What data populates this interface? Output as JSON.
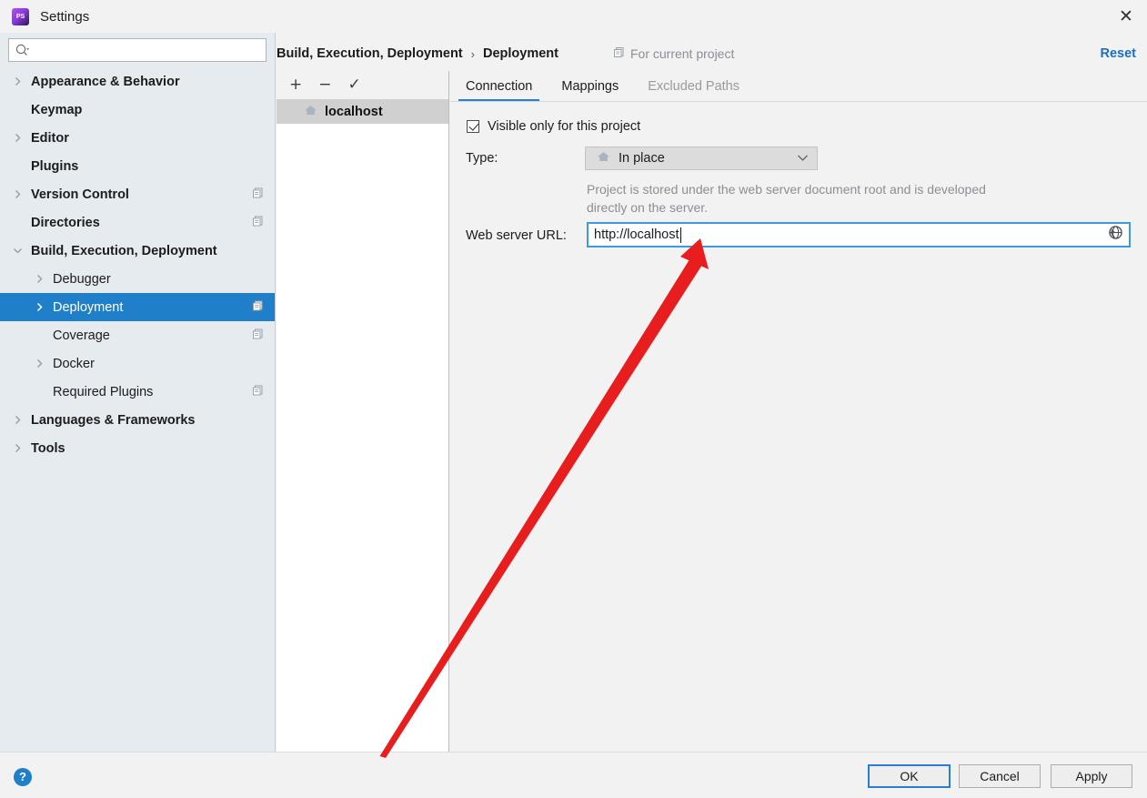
{
  "window": {
    "title": "Settings",
    "app_icon": "phpstorm-icon",
    "close_icon": "close-icon"
  },
  "sidebar": {
    "search": {
      "placeholder": "",
      "value": "",
      "icon": "search-icon"
    },
    "items": [
      {
        "label": "Appearance & Behavior",
        "level": 0,
        "bold": true,
        "arrow": "chevron-right-icon",
        "config_icon": false,
        "selected": false
      },
      {
        "label": "Keymap",
        "level": 0,
        "bold": true,
        "arrow": "none",
        "config_icon": false,
        "selected": false
      },
      {
        "label": "Editor",
        "level": 0,
        "bold": true,
        "arrow": "chevron-right-icon",
        "config_icon": false,
        "selected": false
      },
      {
        "label": "Plugins",
        "level": 0,
        "bold": true,
        "arrow": "none",
        "config_icon": false,
        "selected": false
      },
      {
        "label": "Version Control",
        "level": 0,
        "bold": true,
        "arrow": "chevron-right-icon",
        "config_icon": true,
        "selected": false
      },
      {
        "label": "Directories",
        "level": 0,
        "bold": true,
        "arrow": "none",
        "config_icon": true,
        "selected": false
      },
      {
        "label": "Build, Execution, Deployment",
        "level": 0,
        "bold": true,
        "arrow": "chevron-down-icon",
        "config_icon": false,
        "selected": false
      },
      {
        "label": "Debugger",
        "level": 1,
        "bold": false,
        "arrow": "chevron-right-icon",
        "config_icon": false,
        "selected": false
      },
      {
        "label": "Deployment",
        "level": 1,
        "bold": false,
        "arrow": "chevron-right-icon",
        "config_icon": true,
        "selected": true
      },
      {
        "label": "Coverage",
        "level": 1,
        "bold": false,
        "arrow": "none",
        "config_icon": true,
        "selected": false
      },
      {
        "label": "Docker",
        "level": 1,
        "bold": false,
        "arrow": "chevron-right-icon",
        "config_icon": false,
        "selected": false
      },
      {
        "label": "Required Plugins",
        "level": 1,
        "bold": false,
        "arrow": "none",
        "config_icon": true,
        "selected": false
      },
      {
        "label": "Languages & Frameworks",
        "level": 0,
        "bold": true,
        "arrow": "chevron-right-icon",
        "config_icon": false,
        "selected": false
      },
      {
        "label": "Tools",
        "level": 0,
        "bold": true,
        "arrow": "chevron-right-icon",
        "config_icon": false,
        "selected": false
      }
    ]
  },
  "header": {
    "breadcrumb": [
      "Build, Execution, Deployment",
      "Deployment"
    ],
    "separator": "›",
    "for_current_project": "For current project",
    "for_current_project_icon": "project-config-icon",
    "reset": "Reset"
  },
  "server_list": {
    "toolbar": {
      "add": "+",
      "remove": "−",
      "set_default": "✓"
    },
    "items": [
      {
        "label": "localhost",
        "icon": "home-icon",
        "selected": true
      }
    ]
  },
  "tabs": [
    {
      "label": "Connection",
      "active": true,
      "disabled": false
    },
    {
      "label": "Mappings",
      "active": false,
      "disabled": false
    },
    {
      "label": "Excluded Paths",
      "active": false,
      "disabled": true
    }
  ],
  "form": {
    "visible_only_checkbox": {
      "label": "Visible only for this project",
      "checked": true
    },
    "type_label": "Type:",
    "type_value": "In place",
    "type_icon": "home-icon",
    "type_dropdown_icon": "chevron-down-icon",
    "description": "Project is stored under the web server document root and is developed directly on the server.",
    "url_label": "Web server URL:",
    "url_value": "http://localhost",
    "url_trailing_icon": "globe-icon",
    "url_focused": true
  },
  "footer": {
    "help": "?",
    "ok": "OK",
    "cancel": "Cancel",
    "apply": "Apply"
  },
  "annotation": {
    "type": "arrow",
    "color": "#e81d1d",
    "points_to": "web-server-url-field"
  },
  "colors": {
    "accent_blue": "#1f7fc9",
    "selection_blue": "#1f7fc9",
    "tab_underline": "#2b7cd3",
    "sidebar_bg": "#e6ebf0",
    "panel_bg": "#f2f2f2",
    "annotation_red": "#e81d1d"
  }
}
